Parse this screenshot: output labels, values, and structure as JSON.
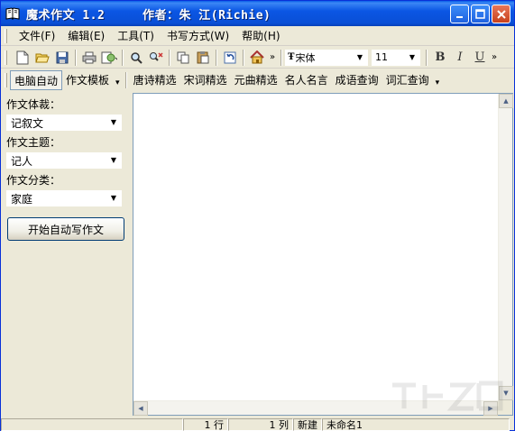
{
  "window": {
    "title": "魔术作文 1.2     作者：朱 江(Richie)"
  },
  "menu": {
    "items": [
      "文件(F)",
      "编辑(E)",
      "工具(T)",
      "书写方式(W)",
      "帮助(H)"
    ]
  },
  "toolbar": {
    "font_name": "宋体",
    "font_size": "11",
    "bold_label": "B",
    "italic_label": "I",
    "underline_label": "U"
  },
  "tabs": {
    "items": [
      "电脑自动",
      "作文模板",
      "唐诗精选",
      "宋词精选",
      "元曲精选",
      "名人名言",
      "成语查询",
      "词汇查询"
    ]
  },
  "left_panel": {
    "genre_label": "作文体裁：",
    "genre_value": "记叙文",
    "theme_label": "作文主题：",
    "theme_value": "记人",
    "category_label": "作文分类：",
    "category_value": "家庭",
    "start_button": "开始自动写作文"
  },
  "status": {
    "row": "1 行",
    "col": "1 列",
    "state": "新建",
    "filename": "未命名1"
  },
  "colors": {
    "titlebar": "#0b56e4",
    "face": "#ece9d8",
    "accent_border": "#7f9db9"
  }
}
